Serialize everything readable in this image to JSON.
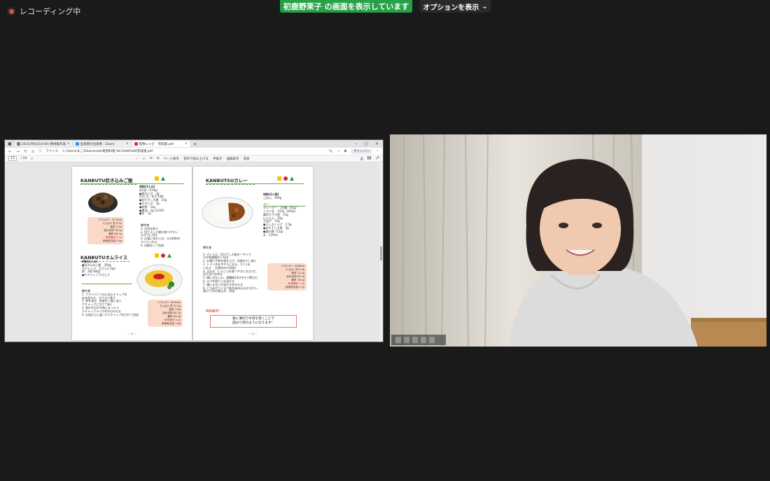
{
  "recording": {
    "label": "レコーディング中"
  },
  "share_banner": {
    "label": "初鹿野茉子 の画面を表示しています"
  },
  "options_button": {
    "label": "オプションを表示"
  },
  "browser": {
    "tabs": [
      {
        "label": "20210903(10:00) 教材集作成打…"
      },
      {
        "label": "出席者の出席者 - Zoom"
      },
      {
        "label": "乾物レシピ　完成版.pdf"
      }
    ],
    "url_prefix": "ファイル",
    "url": "C:/Users/まこ/Downloads/乾物料理 %E3%80%80完成版.pdf",
    "signin_label": "サインイン",
    "pdf_toolbar": {
      "page_current": "13",
      "page_total": "/ 24",
      "page_view": "ページ表示",
      "read_aloud": "音声で読み上げる",
      "draw": "手描き",
      "highlight": "強調表示",
      "erase": "消去"
    }
  },
  "pdf": {
    "left_page": {
      "recipe1": {
        "title": "KANBUTU炊き込みご飯",
        "ingredients_head": "材料(2人分)",
        "ingredients": [
          "米1合（150g）",
          "●塩ひじき　3g",
          "(ひじき・切干大根)",
          "●切り干し大根　10g",
          "●干ひじき　3g",
          "●乾物　1kg",
          "●醤油　2g (大1杯)",
          "●水　7g"
        ],
        "nutrition": [
          "エネルギー 377kcal",
          "たんぱく質 8.5g",
          "脂質 2.2g",
          "炭水化物 78.4g",
          "糖質 66.7g",
          "食物繊維 6.1g",
          "食塩相当量 0.8g"
        ],
        "method_head": "作り方",
        "method": [
          "1. 白米を研ぐ",
          "2. 切り干し大根を食べやすい",
          "   大きさに切る",
          "3. お釜に米を入れ、⑤の材料を",
          "   すべて入れる",
          "4. 炊飯をして完成"
        ]
      },
      "recipe2": {
        "title": "KANBUTUオムライス",
        "ingredients_head": "材料(2人分)",
        "ingredients": [
          "●炊き込みご飯　300g",
          "ケチャップ　大さじ2 (4g)",
          "卵　2個 (80g)",
          "●ケチャップ 大さじ1"
        ],
        "nutrition": [
          "エネルギー 404kcal",
          "たんぱく質 15.2g",
          "脂質 7.8g",
          "炭水化物 65.7g",
          "糖質 61.9g",
          "食物繊維 3.8g",
          "食塩相当量 1.8g"
        ],
        "method_head": "作り方",
        "method": [
          "1. フライパンで①に加えチャップを",
          "   炒め合わせ、チワルに移す",
          "2. 卵を溶き、卵液を一度に流入",
          "   ケチャップにかけて焼く",
          "3. 卵の半分が半熟になったら",
          "   ケチャップライスを中心のせる",
          "4. お皿の上に盛ってケチャップをかけて完成"
        ]
      },
      "page_number": "－ 11 －"
    },
    "right_page": {
      "title": "KANBUTSUカレー",
      "ingredients_head": "材料(2人前)",
      "ingredients": [
        "ごはん　300g",
        "ルー",
        "カレールー　1/4箱（45g）",
        "トマト缶　1/2缶（200g）",
        "舞切り干大根　15g",
        "にんじん　30g",
        "玉ねぎ　70g",
        "●干しきくらげ　2.5g",
        "●切り干し大根　5g",
        "●鶏小間（12g）",
        "水　230ml"
      ],
      "nutrition": [
        "エネルギー 436kcal",
        "たんぱく質 9.3g",
        "脂質 12.4g",
        "炭水化物 83.7g",
        "糖質 76.4g",
        "食物繊維 7.3g",
        "食塩相当量 2.7g"
      ],
      "method_head": "作り方",
      "method": [
        "1. きくらげ、切り干し大根を一やくで",
        "   1cm程度細かく切る",
        "2. お鍋に牛肉を透き上げ、両面を少し焼く",
        "3. トマト缶を牛がらにお汁、1２２を",
        "   いれる　（出物を炒す詳紙）",
        "4. 玉ねぎ、にんじんを食べやすい大きさに",
        "   切り油で炒める",
        "5. 鍋に水を入れ、沸騰後10分中火で煮込む",
        "6. ルウを割り入れ混ぜる",
        "7. 鍋にまぜいか混ぜる合わせる",
        "8. とろみがつくまで味を染み込ませながら、",
        "   弱火で10分煮込み、完成"
      ],
      "point_label": "POINT!",
      "point_text": [
        "麩に薄切り牛肉を巻くことで",
        "固まり肉のようになります！"
      ],
      "page_number": "－ 12 －"
    }
  },
  "colors": {
    "share_green": "#26a148",
    "marker_yellow": "#f2c300",
    "marker_red": "#e0222a",
    "marker_green": "#2f9a44",
    "nutrition_bg": "#fbd9c8",
    "record_red": "#e5484d"
  },
  "icons": {
    "record": "record-dot-icon",
    "chevron": "chevron-down-icon"
  }
}
